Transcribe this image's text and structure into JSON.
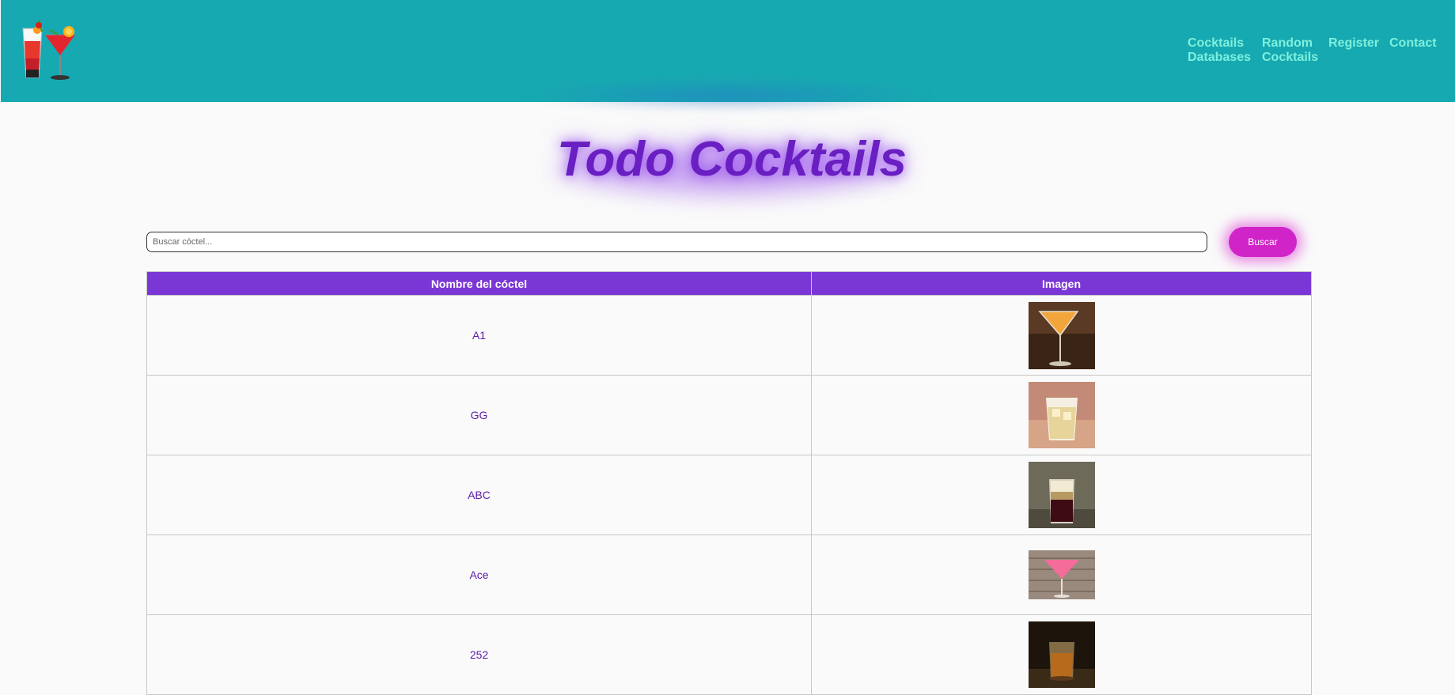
{
  "header": {
    "logo": "cocktail-glasses-logo",
    "accent_color": "#17a9b1",
    "nav": [
      {
        "label": "Cocktails\nDatabases"
      },
      {
        "label": "Random\nCocktails"
      },
      {
        "label": "Register"
      },
      {
        "label": "Contact"
      }
    ]
  },
  "main": {
    "title": "Todo Cocktails",
    "search": {
      "placeholder": "Buscar cóctel...",
      "value": "",
      "button_label": "Buscar"
    },
    "table": {
      "columns": [
        "Nombre del cóctel",
        "Imagen"
      ],
      "rows": [
        {
          "name": "A1",
          "image": "orange-cocktail-in-martini-glass"
        },
        {
          "name": "GG",
          "image": "yellow-drink-in-rocks-glass"
        },
        {
          "name": "ABC",
          "image": "layered-shot-glass"
        },
        {
          "name": "Ace",
          "image": "pink-cocktail-in-martini-glass"
        },
        {
          "name": "252",
          "image": "amber-shot-glass"
        }
      ]
    }
  },
  "colors": {
    "header_bg": "#17a9b1",
    "nav_text": "#7ef0dd",
    "title": "#6a1fc2",
    "table_header": "#7b37d6",
    "button": "#d024c8"
  }
}
